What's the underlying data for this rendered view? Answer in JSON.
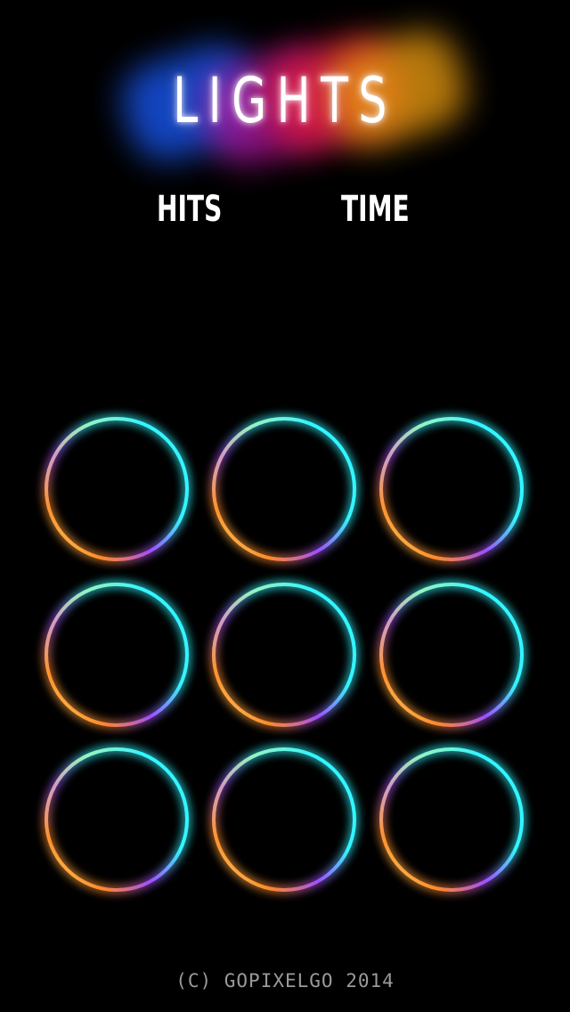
{
  "header": {
    "title": "LIGHTS"
  },
  "stats": {
    "hits_label": "HITS",
    "time_label": "TIME"
  },
  "board": {
    "rows": 3,
    "cols": 3,
    "ring_colors": [
      "#33f5ff",
      "#a24dff",
      "#ff8a2a",
      "#fff27a"
    ]
  },
  "footer": {
    "copyright": "(C) GOPIXELGO 2014"
  }
}
